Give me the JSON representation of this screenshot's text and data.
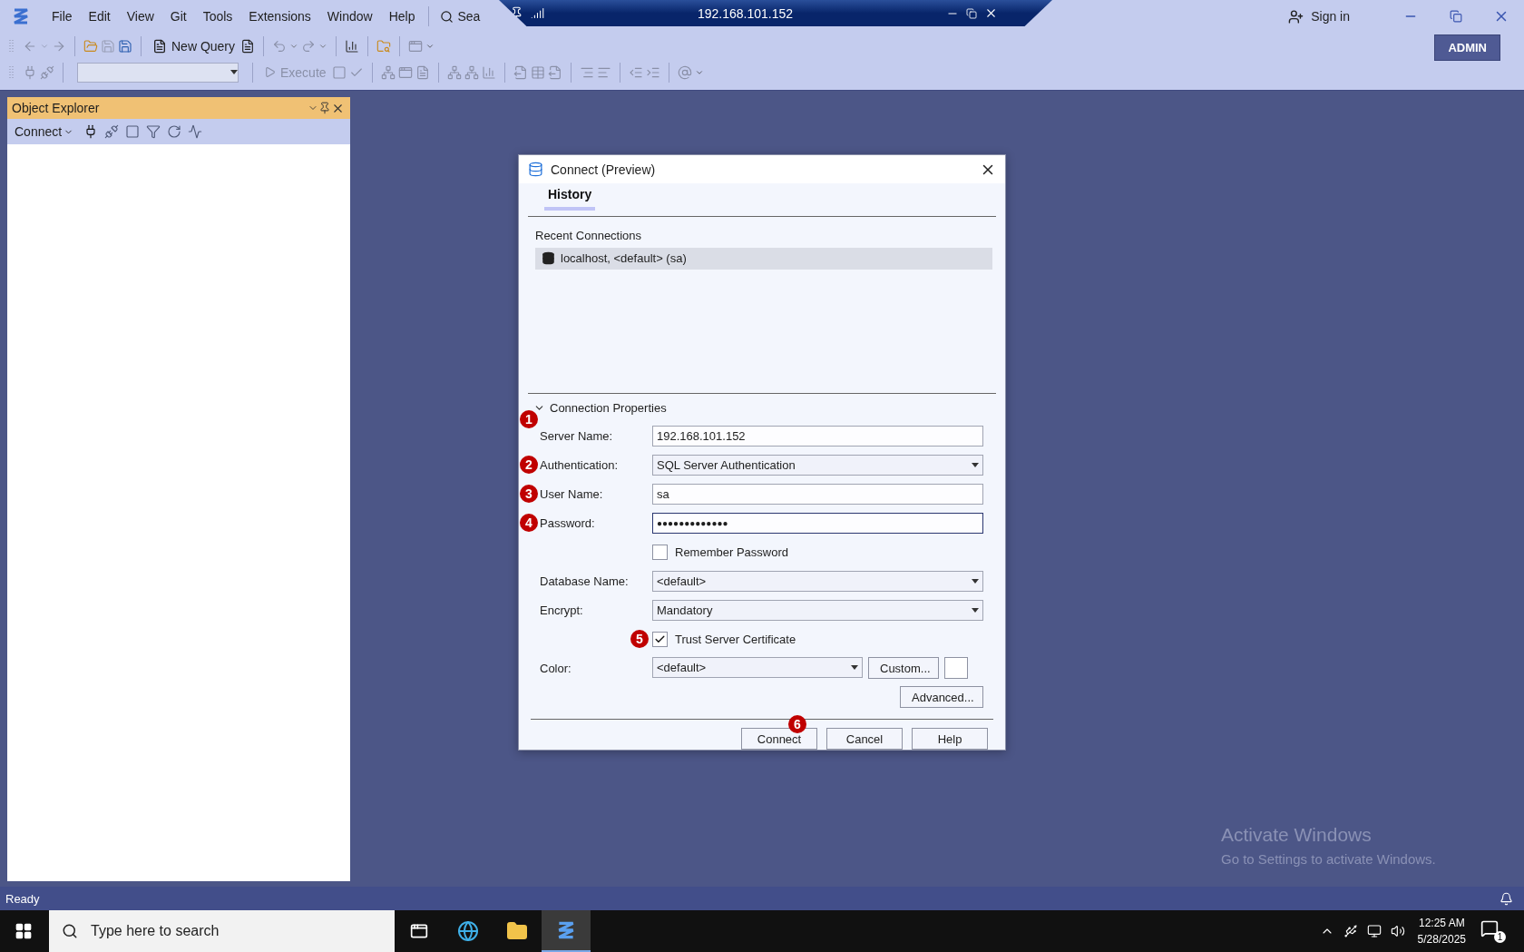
{
  "menu_bar": {
    "items": [
      "File",
      "Edit",
      "View",
      "Git",
      "Tools",
      "Extensions",
      "Window",
      "Help"
    ],
    "search": "Sea",
    "sign_in": "Sign in",
    "account_badge": "ADMIN"
  },
  "remote_bar": {
    "title": "192.168.101.152"
  },
  "toolbar": {
    "new_query": "New Query",
    "execute": {
      "label": "Execute",
      "disabled": true
    }
  },
  "object_explorer": {
    "title": "Object Explorer",
    "connect": "Connect"
  },
  "dialog": {
    "title": "Connect (Preview)",
    "tabs": [
      {
        "label": "History",
        "selected": true
      }
    ],
    "recent_heading": "Recent Connections",
    "recent": [
      {
        "label": "localhost, <default> (sa)",
        "selected": true
      }
    ],
    "section": {
      "label": "Connection Properties",
      "expanded": true
    },
    "fields": [
      {
        "kind": "text",
        "label": "Server Name:",
        "value": "192.168.101.152",
        "badge": "1"
      },
      {
        "kind": "select",
        "label": "Authentication:",
        "value": "SQL Server Authentication",
        "badge": "2"
      },
      {
        "kind": "text",
        "label": "User Name:",
        "value": "sa",
        "badge": "3"
      },
      {
        "kind": "password",
        "label": "Password:",
        "value": "●●●●●●●●●●●●●",
        "badge": "4",
        "focused": true
      },
      {
        "kind": "checkbox",
        "label": "Remember Password",
        "checked": false
      },
      {
        "kind": "select",
        "label": "Database Name:",
        "value": "<default>"
      },
      {
        "kind": "select",
        "label": "Encrypt:",
        "value": "Mandatory"
      },
      {
        "kind": "checkbox",
        "label": "Trust Server Certificate",
        "checked": true,
        "badge": "5"
      },
      {
        "kind": "color",
        "label": "Color:",
        "value": "<default>",
        "button": "Custom..."
      }
    ],
    "advanced": "Advanced...",
    "buttons": [
      {
        "label": "Connect",
        "badge": "6"
      },
      {
        "label": "Cancel"
      },
      {
        "label": "Help"
      }
    ]
  },
  "status_bar": {
    "text": "Ready"
  },
  "activation_notice": {
    "title": "Activate Windows",
    "text": "Go to Settings to activate Windows."
  },
  "taskbar": {
    "search_placeholder": "Type here to search",
    "time": "12:25 AM",
    "date": "5/28/2025",
    "notification_count": "1"
  }
}
